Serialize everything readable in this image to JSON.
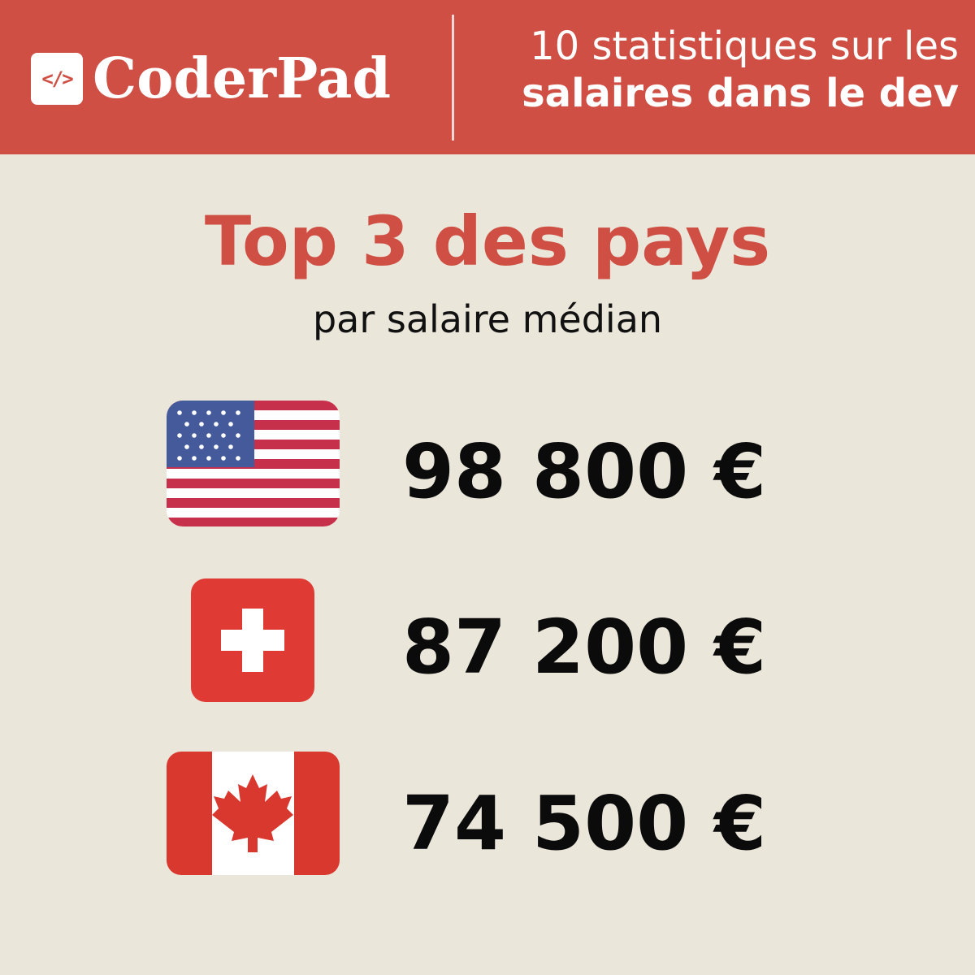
{
  "header": {
    "brand": "CoderPad",
    "logo_mark": "</>",
    "title_line1": "10 statistiques sur les",
    "title_line2": "salaires dans le dev",
    "background_color": "#cf4f44"
  },
  "main": {
    "title": "Top 3 des pays",
    "subtitle": "par salaire médian",
    "title_color": "#cf4f44",
    "background_color": "#ebe6da"
  },
  "rows": [
    {
      "flag_icon": "us-flag-icon",
      "value": "98 800 €"
    },
    {
      "flag_icon": "swiss-flag-icon",
      "value": "87 200 €"
    },
    {
      "flag_icon": "canada-flag-icon",
      "value": "74 500 €"
    }
  ]
}
